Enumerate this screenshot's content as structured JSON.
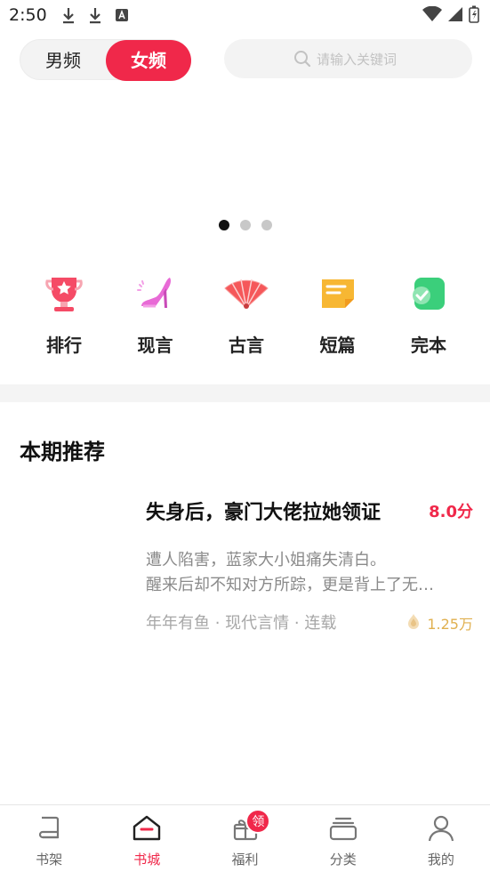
{
  "statusbar": {
    "time": "2:50"
  },
  "gender_switch": {
    "male": "男频",
    "female": "女频",
    "selected": "女频"
  },
  "search": {
    "placeholder": "请输入关键词"
  },
  "banner": {
    "pages": 3,
    "active_page": 1
  },
  "categories": [
    {
      "label": "排行",
      "icon": "trophy-icon"
    },
    {
      "label": "现言",
      "icon": "high-heel-icon"
    },
    {
      "label": "古言",
      "icon": "fan-icon"
    },
    {
      "label": "短篇",
      "icon": "note-icon"
    },
    {
      "label": "完本",
      "icon": "check-square-icon"
    }
  ],
  "recommend": {
    "title": "本期推荐",
    "book": {
      "title": "失身后，豪门大佬拉她领证",
      "score": "8.0分",
      "desc_line1": "遭人陷害，蓝家大小姐痛失清白。",
      "desc_line2": "醒来后却不知对方所踪，更是背上了无…",
      "meta": "年年有鱼 · 现代言情 · 连载",
      "heat": "1.25万"
    }
  },
  "tabbar": {
    "items": [
      {
        "label": "书架",
        "icon": "bookshelf-icon"
      },
      {
        "label": "书城",
        "icon": "store-icon"
      },
      {
        "label": "福利",
        "icon": "gift-icon",
        "badge": "领"
      },
      {
        "label": "分类",
        "icon": "category-icon"
      },
      {
        "label": "我的",
        "icon": "profile-icon"
      }
    ],
    "active": "书城"
  },
  "colors": {
    "accent": "#f0284a",
    "heat": "#e0b04f"
  }
}
